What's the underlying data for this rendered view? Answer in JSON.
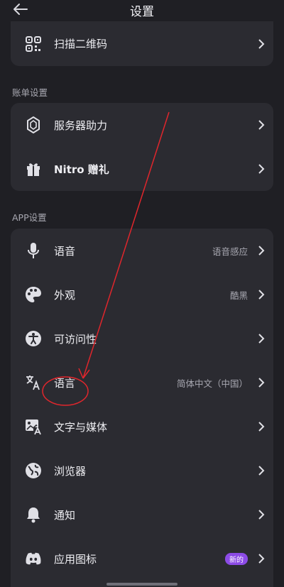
{
  "header": {
    "title": "设置"
  },
  "top_item": {
    "label": "扫描二维码",
    "icon": "qr-scan-icon"
  },
  "billing": {
    "section_label": "账单设置",
    "items": [
      {
        "label": "服务器助力",
        "icon": "boost-icon"
      },
      {
        "label": "Nitro 赠礼",
        "icon": "gift-icon"
      }
    ]
  },
  "app": {
    "section_label": "APP设置",
    "items": [
      {
        "label": "语音",
        "value": "语音感应",
        "icon": "microphone-icon"
      },
      {
        "label": "外观",
        "value": "酷黑",
        "icon": "palette-icon"
      },
      {
        "label": "可访问性",
        "value": "",
        "icon": "accessibility-icon"
      },
      {
        "label": "语言",
        "value": "简体中文（中国）",
        "icon": "translate-icon"
      },
      {
        "label": "文字与媒体",
        "value": "",
        "icon": "image-text-icon"
      },
      {
        "label": "浏览器",
        "value": "",
        "icon": "globe-icon"
      },
      {
        "label": "通知",
        "value": "",
        "icon": "bell-icon"
      },
      {
        "label": "应用图标",
        "value": "",
        "badge": "新的",
        "icon": "discord-icon"
      }
    ]
  },
  "colors": {
    "background": "#1f1f24",
    "card": "#2b2b31",
    "annotation": "#e0262c",
    "badge": "#8c4be6"
  }
}
